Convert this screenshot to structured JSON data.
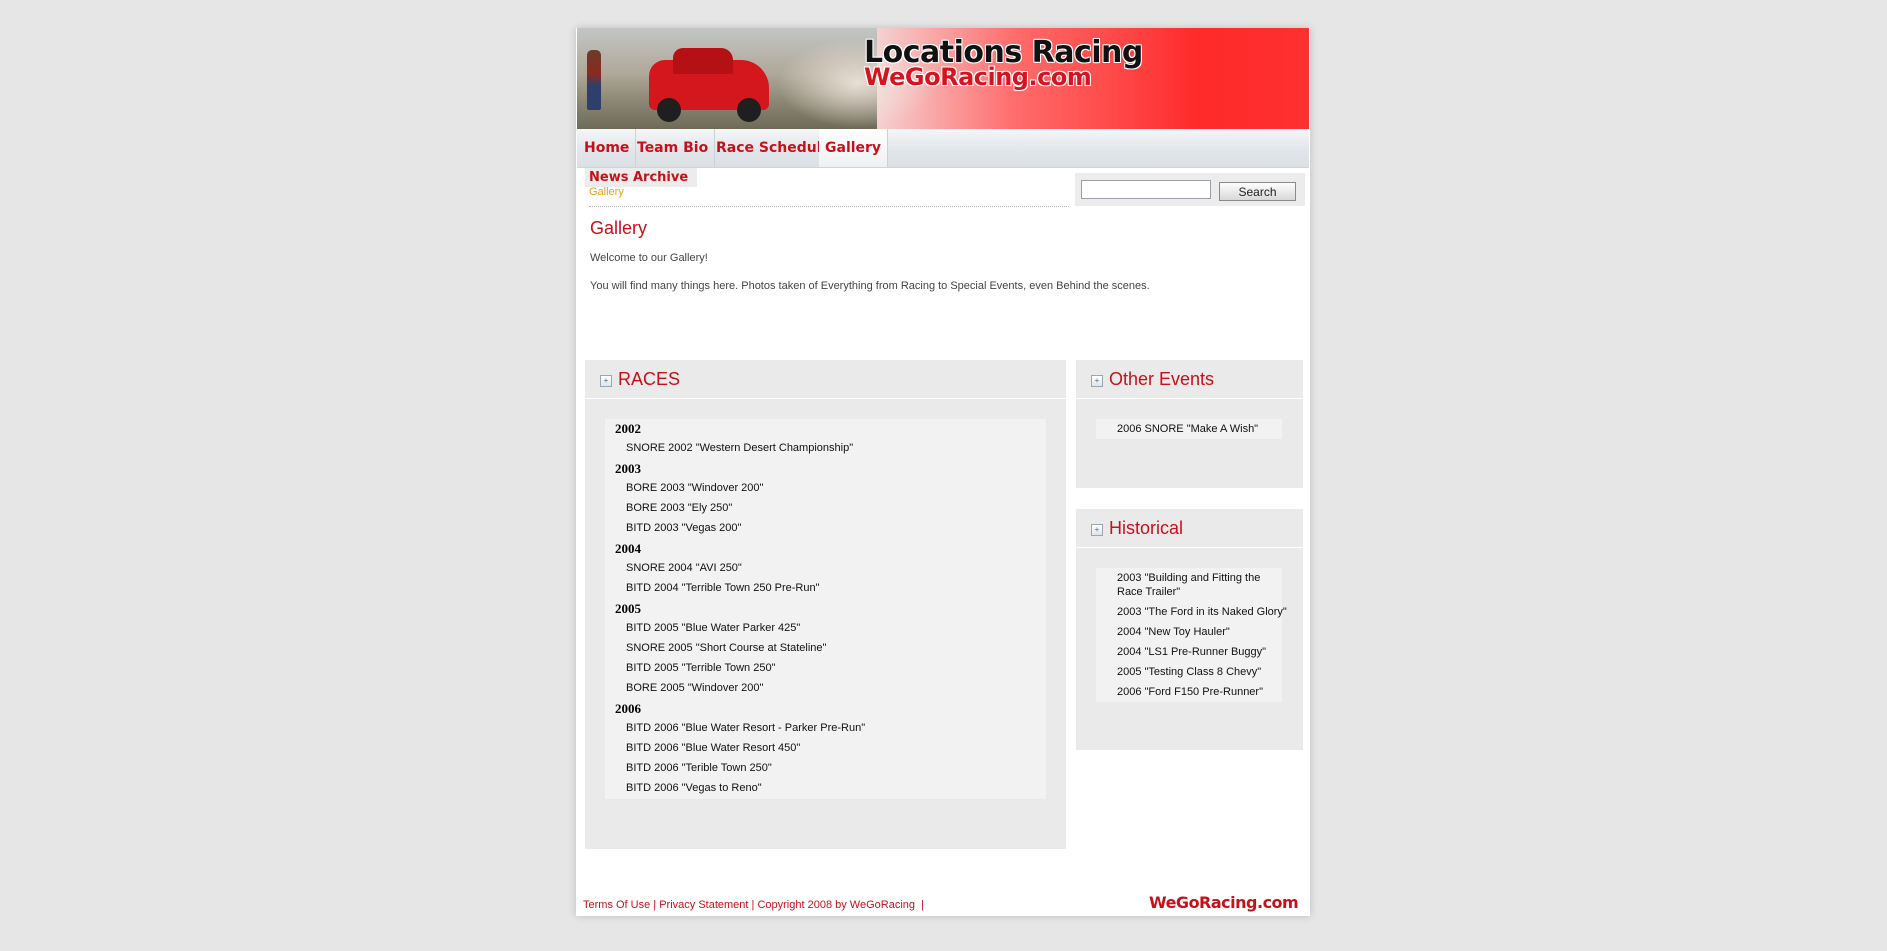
{
  "header": {
    "title": "Locations Racing",
    "subtitle": "WeGoRacing.com"
  },
  "nav": {
    "items": [
      "Home",
      "Team Bio",
      "Race Schedule",
      "Gallery"
    ]
  },
  "sidebar_tab": "News Archive",
  "breadcrumb": "Gallery",
  "search": {
    "value": "",
    "button_label": "Search"
  },
  "content": {
    "title": "Gallery",
    "intro": "Welcome to our Gallery!",
    "body": "You will find many things here. Photos taken of Everything from Racing to Special Events, even Behind the scenes."
  },
  "races": {
    "title": "RACES",
    "toggle": "+",
    "groups": [
      {
        "year": "2002",
        "items": [
          "SNORE 2002 \"Western Desert Championship\""
        ]
      },
      {
        "year": "2003",
        "items": [
          "BORE 2003 \"Windover 200\"",
          "BORE 2003 \"Ely 250\"",
          "BITD 2003 \"Vegas 200\""
        ]
      },
      {
        "year": "2004",
        "items": [
          "SNORE 2004 \"AVI 250\"",
          "BITD 2004 \"Terrible Town 250 Pre-Run\""
        ]
      },
      {
        "year": "2005",
        "items": [
          "BITD 2005 \"Blue Water Parker 425\"",
          "SNORE 2005 \"Short Course at Stateline\"",
          "BITD 2005 \"Terrible Town 250\"",
          "BORE 2005 \"Windover 200\""
        ]
      },
      {
        "year": "2006",
        "items": [
          "BITD 2006 \"Blue Water Resort - Parker Pre-Run\"",
          "BITD 2006 \"Blue Water Resort 450\"",
          "BITD 2006 \"Terible Town 250\"",
          "BITD 2006 \"Vegas to Reno\""
        ]
      }
    ]
  },
  "other_events": {
    "title": "Other Events",
    "toggle": "+",
    "items": [
      "2006 SNORE \"Make A Wish\""
    ]
  },
  "historical": {
    "title": "Historical",
    "toggle": "+",
    "items": [
      "2003 \"Building and Fitting the Race Trailer\"",
      "2003 \"The Ford in its Naked Glory\"",
      "2004 \"New Toy Hauler\"",
      "2004 \"LS1 Pre-Runner Buggy\"",
      "2005 \"Testing Class 8 Chevy\"",
      "2006 \"Ford F150 Pre-Runner\""
    ]
  },
  "footer": {
    "terms": "Terms Of Use",
    "privacy": "Privacy Statement",
    "copyright": "Copyright 2008 by WeGoRacing",
    "separator": "|",
    "logo": "WeGoRacing.com"
  },
  "colors": {
    "accent": "#c8101a",
    "breadcrumb": "#e6a117",
    "page_bg": "#e6e6e6",
    "panel_bg": "#eaeaea"
  }
}
